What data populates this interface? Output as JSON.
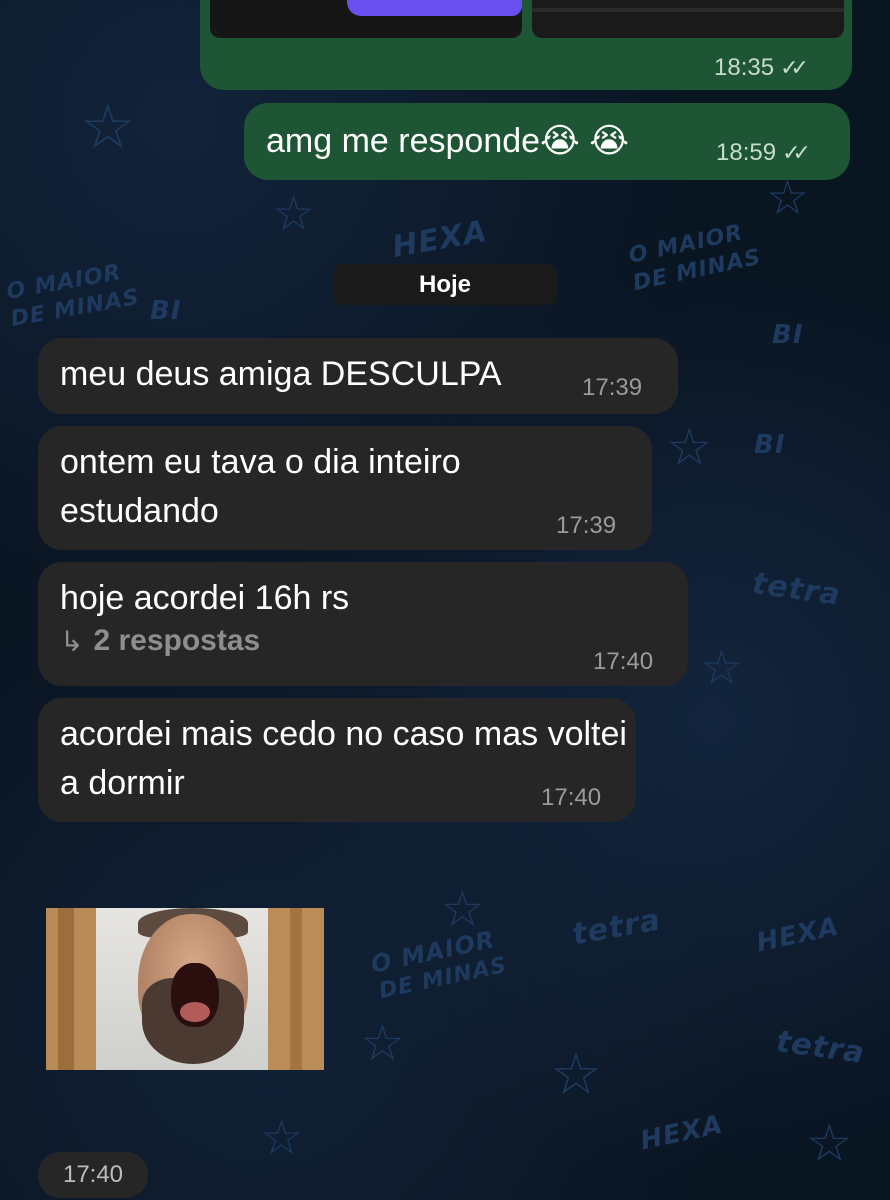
{
  "wallpaper": {
    "texts": [
      "HEXA",
      "O MAIOR",
      "DE MINAS",
      "BI",
      "tetra",
      "HEXA",
      "O MAIOR",
      "DE MINAS",
      "tetra",
      "BI",
      "HEXA",
      "tetra",
      "O MAIOR",
      "DE MINAS",
      "BI"
    ]
  },
  "messages_out": [
    {
      "type": "media",
      "time": "18:35",
      "status_icon": "double-check-icon"
    },
    {
      "type": "text",
      "text": "amg me responde😭 😭",
      "time": "18:59",
      "status_icon": "double-check-icon"
    }
  ],
  "date_separator": "Hoje",
  "messages_in": [
    {
      "text": "meu deus amiga DESCULPA",
      "time": "17:39"
    },
    {
      "text": "ontem eu tava o dia inteiro estudando",
      "time": "17:39"
    },
    {
      "text": "hoje acordei 16h rs",
      "replies": "2 respostas",
      "time": "17:40"
    },
    {
      "text": "acordei mais cedo no caso mas voltei a dormir",
      "time": "17:40"
    }
  ],
  "sticker": {
    "time": "17:40"
  },
  "colors": {
    "outgoing_bubble": "#1d5535",
    "incoming_bubble": "#262626",
    "background": "#0a1522"
  }
}
